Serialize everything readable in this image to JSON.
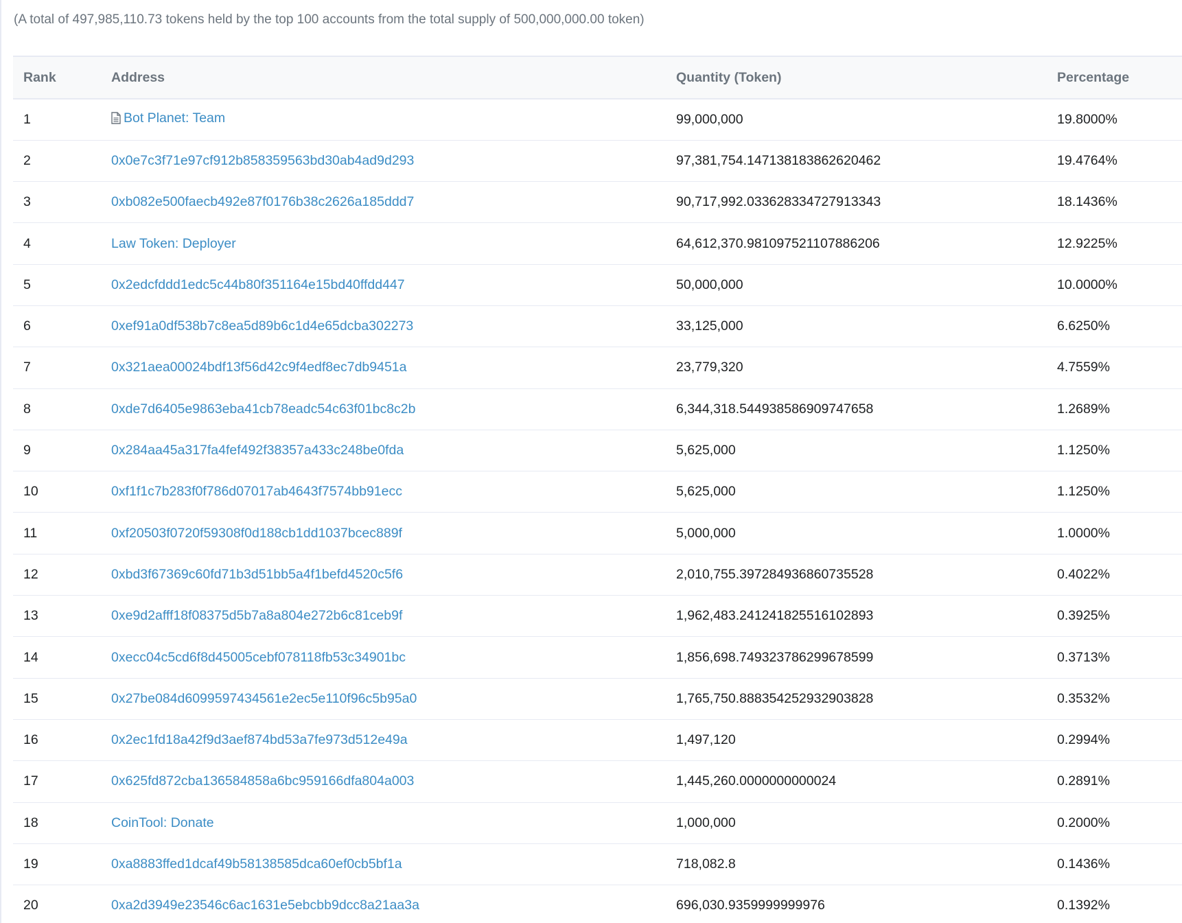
{
  "summary": "(A total of 497,985,110.73 tokens held by the top 100 accounts from the total supply of 500,000,000.00 token)",
  "table": {
    "headers": {
      "rank": "Rank",
      "address": "Address",
      "quantity": "Quantity (Token)",
      "percentage": "Percentage"
    },
    "rows": [
      {
        "rank": "1",
        "address": "Bot Planet: Team",
        "icon": "contract-doc-icon",
        "quantity": "99,000,000",
        "percentage": "19.8000%"
      },
      {
        "rank": "2",
        "address": "0x0e7c3f71e97cf912b858359563bd30ab4ad9d293",
        "quantity": "97,381,754.147138183862620462",
        "percentage": "19.4764%"
      },
      {
        "rank": "3",
        "address": "0xb082e500faecb492e87f0176b38c2626a185ddd7",
        "quantity": "90,717,992.033628334727913343",
        "percentage": "18.1436%"
      },
      {
        "rank": "4",
        "address": "Law Token: Deployer",
        "quantity": "64,612,370.981097521107886206",
        "percentage": "12.9225%"
      },
      {
        "rank": "5",
        "address": "0x2edcfddd1edc5c44b80f351164e15bd40ffdd447",
        "quantity": "50,000,000",
        "percentage": "10.0000%"
      },
      {
        "rank": "6",
        "address": "0xef91a0df538b7c8ea5d89b6c1d4e65dcba302273",
        "quantity": "33,125,000",
        "percentage": "6.6250%"
      },
      {
        "rank": "7",
        "address": "0x321aea00024bdf13f56d42c9f4edf8ec7db9451a",
        "quantity": "23,779,320",
        "percentage": "4.7559%"
      },
      {
        "rank": "8",
        "address": "0xde7d6405e9863eba41cb78eadc54c63f01bc8c2b",
        "quantity": "6,344,318.544938586909747658",
        "percentage": "1.2689%"
      },
      {
        "rank": "9",
        "address": "0x284aa45a317fa4fef492f38357a433c248be0fda",
        "quantity": "5,625,000",
        "percentage": "1.1250%"
      },
      {
        "rank": "10",
        "address": "0xf1f1c7b283f0f786d07017ab4643f7574bb91ecc",
        "quantity": "5,625,000",
        "percentage": "1.1250%"
      },
      {
        "rank": "11",
        "address": "0xf20503f0720f59308f0d188cb1dd1037bcec889f",
        "quantity": "5,000,000",
        "percentage": "1.0000%"
      },
      {
        "rank": "12",
        "address": "0xbd3f67369c60fd71b3d51bb5a4f1befd4520c5f6",
        "quantity": "2,010,755.397284936860735528",
        "percentage": "0.4022%"
      },
      {
        "rank": "13",
        "address": "0xe9d2afff18f08375d5b7a8a804e272b6c81ceb9f",
        "quantity": "1,962,483.241241825516102893",
        "percentage": "0.3925%"
      },
      {
        "rank": "14",
        "address": "0xecc04c5cd6f8d45005cebf078118fb53c34901bc",
        "quantity": "1,856,698.749323786299678599",
        "percentage": "0.3713%"
      },
      {
        "rank": "15",
        "address": "0x27be084d6099597434561e2ec5e110f96c5b95a0",
        "quantity": "1,765,750.888354252932903828",
        "percentage": "0.3532%"
      },
      {
        "rank": "16",
        "address": "0x2ec1fd18a42f9d3aef874bd53a7fe973d512e49a",
        "quantity": "1,497,120",
        "percentage": "0.2994%"
      },
      {
        "rank": "17",
        "address": "0x625fd872cba136584858a6bc959166dfa804a003",
        "quantity": "1,445,260.0000000000024",
        "percentage": "0.2891%"
      },
      {
        "rank": "18",
        "address": "CoinTool: Donate",
        "quantity": "1,000,000",
        "percentage": "0.2000%"
      },
      {
        "rank": "19",
        "address": "0xa8883ffed1dcaf49b58138585dca60ef0cb5bf1a",
        "quantity": "718,082.8",
        "percentage": "0.1436%"
      },
      {
        "rank": "20",
        "address": "0xa2d3949e23546c6ac1631e5ebcbb9dcc8a21aa3a",
        "quantity": "696,030.9359999999976",
        "percentage": "0.1392%"
      }
    ]
  },
  "colors": {
    "link": "#3c8dc5",
    "header_text": "#6c757e",
    "header_bg": "#f8f9fa",
    "border": "#e7eaf3"
  }
}
